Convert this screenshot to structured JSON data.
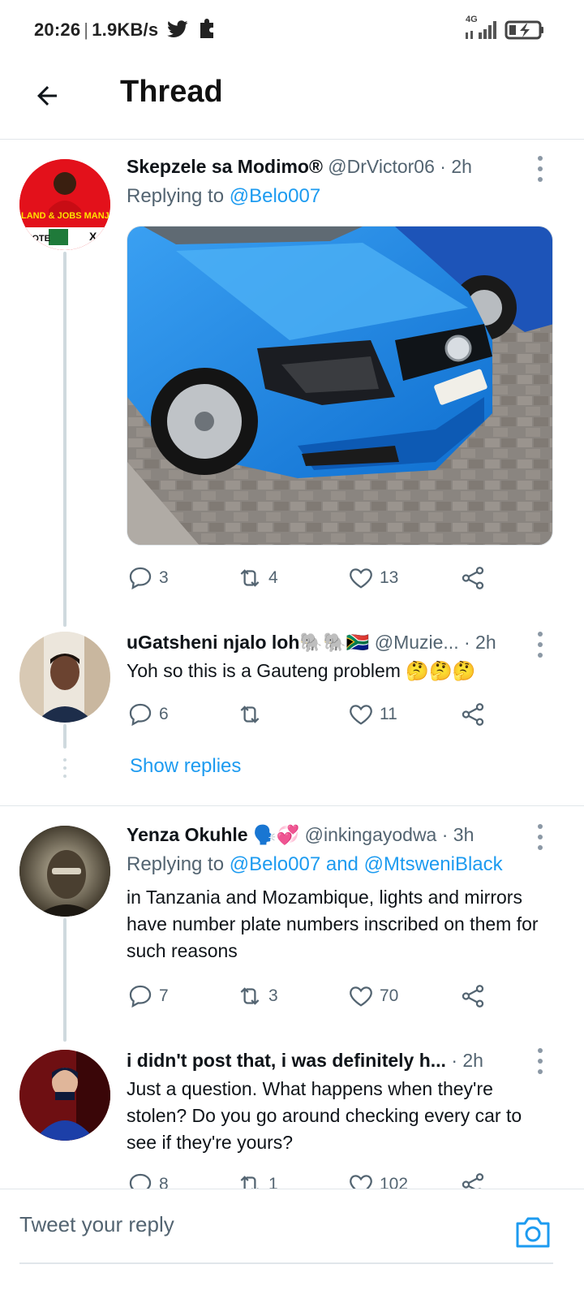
{
  "status_bar": {
    "time": "20:26",
    "network_speed": "1.9KB/s",
    "network_type": "4G",
    "icons": [
      "twitter-bird-icon",
      "puzzle-icon",
      "signal-icon",
      "battery-charging-icon"
    ]
  },
  "header": {
    "title": "Thread",
    "back_icon": "arrow-left-icon"
  },
  "tweets": [
    {
      "name": "Skepzele sa Modimo®",
      "handle": "@DrVictor06",
      "time": "· 2h",
      "reply_prefix": "Replying to ",
      "reply_mentions": "@Belo007",
      "text": "",
      "replies": "3",
      "retweets": "4",
      "likes": "13",
      "avatar_text_top": "LAND & JOBS MANJE!",
      "avatar_text_bottom": "VOTE",
      "avatar_color": "#e3111b"
    },
    {
      "name": "uGatsheni njalo loh🐘🐘🇿🇦",
      "handle": "@Muzie...",
      "time": "· 2h",
      "text": "Yoh so this is a Gauteng problem 🤔🤔🤔",
      "replies": "6",
      "retweets": "",
      "likes": "11"
    },
    {
      "name": "Yenza Okuhle 🗣️💞",
      "handle": "@inkingayodwa",
      "time": "· 3h",
      "reply_prefix": "Replying to ",
      "reply_mentions": "@Belo007 and @MtsweniBlack",
      "text": "in Tanzania and Mozambique, lights and mirrors have number plate numbers inscribed on them for such reasons",
      "replies": "7",
      "retweets": "3",
      "likes": "70"
    },
    {
      "name": "i didn't post that, i was definitely h...",
      "handle": "",
      "time": "· 2h",
      "text": "Just a question. What happens when they're stolen? Do you go around checking every car to see if they're yours?",
      "replies": "8",
      "retweets": "1",
      "likes": "102"
    }
  ],
  "show_replies_label": "Show replies",
  "reply_bar": {
    "placeholder": "Tweet your reply",
    "camera_icon": "camera-icon"
  },
  "colors": {
    "accent": "#1d9bf0",
    "secondary_text": "#536471",
    "thread_line": "#cfd9de"
  }
}
